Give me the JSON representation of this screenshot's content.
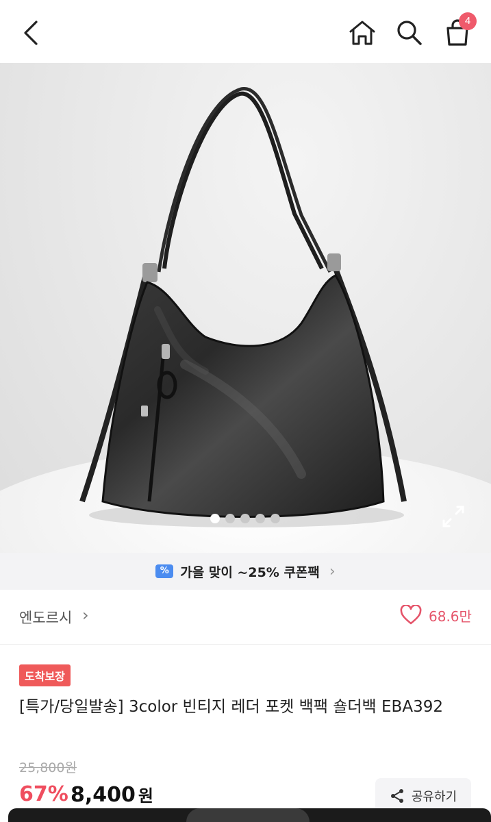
{
  "header": {
    "cart_count": "4",
    "icons": [
      "chevron-left-icon",
      "home-icon",
      "search-icon",
      "shopping-bag-icon"
    ]
  },
  "gallery": {
    "total_images": 5,
    "active_index": 0,
    "expand_icon": "expand-icon"
  },
  "coupon": {
    "icon_glyph": "%",
    "text": "가을 맞이 ~25% 쿠폰팩",
    "chevron": "›"
  },
  "brand": {
    "name": "엔도르시",
    "chevron": "›",
    "like_count": "68.6만",
    "like_color": "#e5546a"
  },
  "product": {
    "badge": "도착보장",
    "title": "[특가/당일발송] 3color 빈티지 레더 포켓 백팩 숄더백 EBA392",
    "original_price": "25,800원",
    "discount": "67%",
    "price": "8,400",
    "price_unit": "원"
  },
  "actions": {
    "share_label": "공유하기"
  },
  "colors": {
    "accent_red": "#ef4e5f",
    "badge_red": "#ef5a5a",
    "coupon_blue": "#4b8cf0"
  }
}
